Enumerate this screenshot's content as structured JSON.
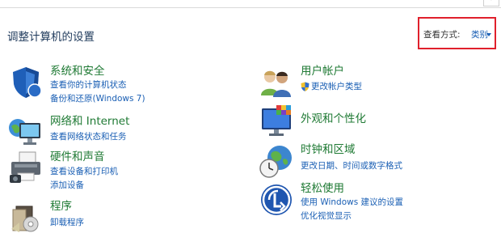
{
  "window": {
    "top_button_glyph": "⚙"
  },
  "header": {
    "title": "调整计算机的设置",
    "view_by_label": "查看方式:",
    "view_by_value": "类别"
  },
  "categories": [
    {
      "title": "系统和安全",
      "icon": "shield-icon",
      "links": [
        "查看你的计算机状态",
        "备份和还原(Windows 7)"
      ]
    },
    {
      "title": "网络和 Internet",
      "icon": "network-icon",
      "links": [
        "查看网络状态和任务"
      ]
    },
    {
      "title": "硬件和声音",
      "icon": "printer-icon",
      "links": [
        "查看设备和打印机",
        "添加设备"
      ]
    },
    {
      "title": "程序",
      "icon": "programs-icon",
      "links": [
        "卸载程序"
      ]
    },
    {
      "title": "用户帐户",
      "icon": "users-icon",
      "links": [
        "更改帐户类型"
      ]
    },
    {
      "title": "外观和个性化",
      "icon": "monitor-icon",
      "links": []
    },
    {
      "title": "时钟和区域",
      "icon": "clock-globe-icon",
      "links": [
        "更改日期、时间或数字格式"
      ]
    },
    {
      "title": "轻松使用",
      "icon": "accessibility-icon",
      "links": [
        "使用 Windows 建议的设置",
        "优化视觉显示"
      ]
    }
  ],
  "colors": {
    "category_title": "#1f7a34",
    "link": "#1a5fb4",
    "highlight_box": "#e0202c"
  }
}
